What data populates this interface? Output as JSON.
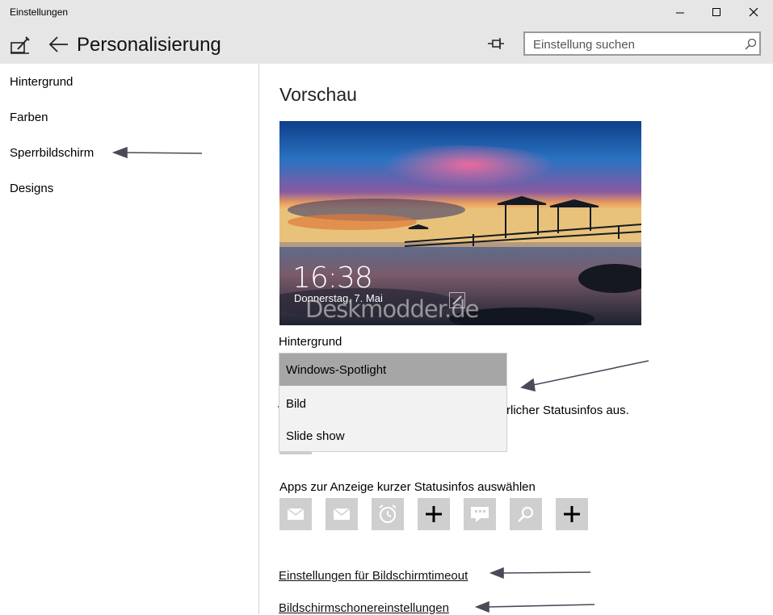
{
  "window": {
    "title": "Einstellungen"
  },
  "header": {
    "title": "Personalisierung",
    "search_placeholder": "Einstellung suchen"
  },
  "sidebar": {
    "items": [
      {
        "label": "Hintergrund"
      },
      {
        "label": "Farben"
      },
      {
        "label": "Sperrbildschirm"
      },
      {
        "label": "Designs"
      }
    ]
  },
  "main": {
    "preview_heading": "Vorschau",
    "lock_time": "16:38",
    "lock_date": "Donnerstag, 7. Mai",
    "watermark": "Deskmodder.de",
    "background_label": "Hintergrund",
    "background_options": [
      "Windows-Spotlight",
      "Bild",
      "Slide show"
    ],
    "detail_status_partial_left": "W",
    "detail_status_partial_right": "rlicher Statusinfos aus.",
    "quick_status_label": "Apps zur Anzeige kurzer Statusinfos auswählen",
    "quick_status_apps": [
      "mail-icon",
      "mail-icon",
      "alarm-icon",
      "add-icon",
      "message-icon",
      "search-icon",
      "add-icon"
    ],
    "link_timeout": "Einstellungen für Bildschirmtimeout",
    "link_screensaver": "Bildschirmschonereinstellungen"
  },
  "colors": {
    "chrome": "#e6e6e6",
    "selected_option": "#a6a6a6",
    "dropdown_bg": "#f2f2f2",
    "tile": "#cfcfcf",
    "annotation_arrow": "#4a4a5a"
  }
}
